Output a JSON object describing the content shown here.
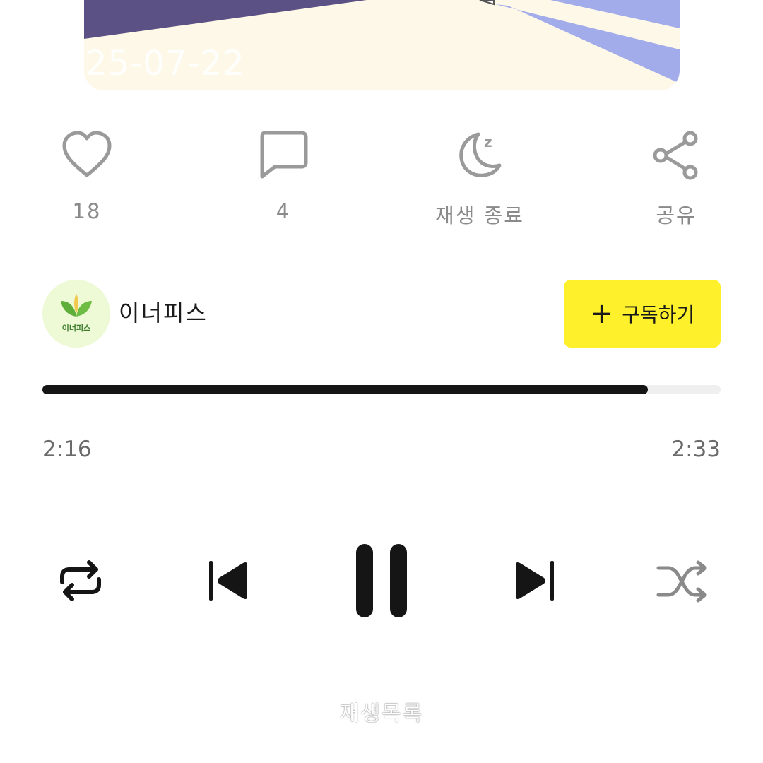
{
  "cover": {
    "date_text": "25-07-22",
    "colors": {
      "background": "#fdf8e8",
      "dark_band": "#5b5184",
      "light_band": "#a2acea"
    }
  },
  "actions": {
    "like": {
      "icon": "heart-icon",
      "count": "18"
    },
    "comment": {
      "icon": "speech-bubble-icon",
      "count": "4"
    },
    "sleep_timer": {
      "icon": "moon-icon",
      "label": "재생 종료"
    },
    "share": {
      "icon": "share-icon",
      "label": "공유"
    }
  },
  "channel": {
    "name": "이너피스",
    "avatar_text": "이너피스",
    "subscribe_label": "구독하기",
    "subscribe_color": "#fff02c"
  },
  "player": {
    "current_time": "2:16",
    "total_time": "2:33",
    "progress": 0.893,
    "is_playing": true,
    "controls": [
      "repeat-icon",
      "previous-icon",
      "pause-icon",
      "next-icon",
      "shuffle-icon"
    ]
  },
  "footer": {
    "playlist_label": "재생목록"
  }
}
